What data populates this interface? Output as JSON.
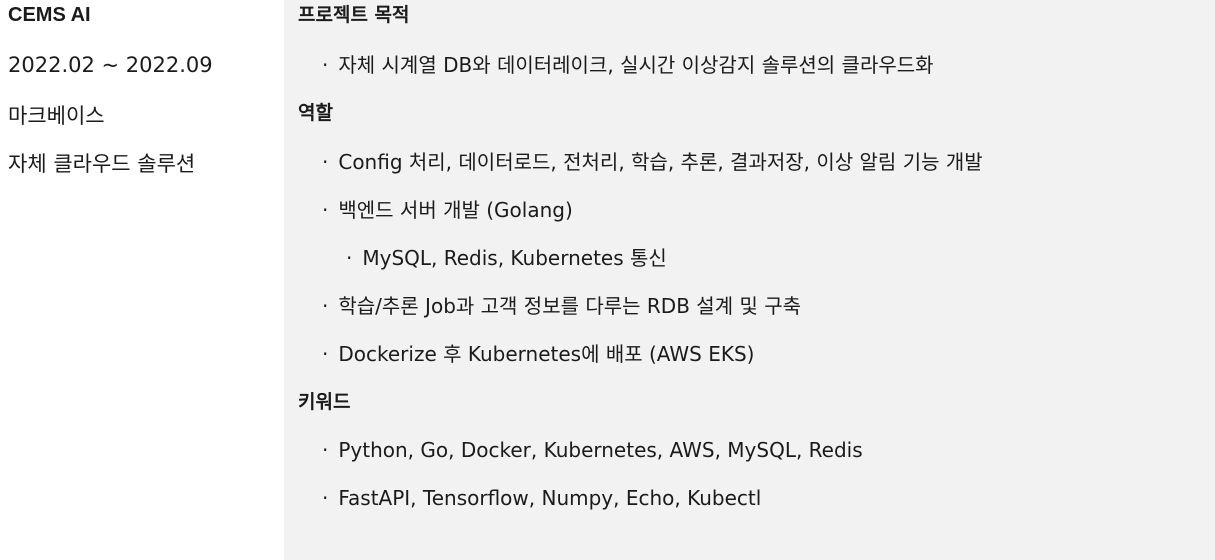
{
  "meta": {
    "company": "CEMS AI",
    "period": "2022.02 ~ 2022.09",
    "client": "마크베이스",
    "project": "자체 클라우드 솔루션"
  },
  "sections": {
    "purpose": {
      "heading": "프로젝트 목적",
      "items": [
        "자체 시계열 DB와 데이터레이크, 실시간 이상감지 솔루션의 클라우드화"
      ]
    },
    "role": {
      "heading": "역할",
      "items": [
        "Config 처리, 데이터로드, 전처리, 학습, 추론, 결과저장, 이상 알림 기능 개발",
        "백엔드 서버 개발 (Golang)",
        "MySQL, Redis, Kubernetes 통신",
        "학습/추론 Job과 고객 정보를 다루는 RDB 설계 및 구축",
        "Dockerize 후 Kubernetes에 배포 (AWS EKS)"
      ]
    },
    "keywords": {
      "heading": "키워드",
      "items": [
        "Python, Go, Docker, Kubernetes, AWS, MySQL, Redis",
        "FastAPI, Tensorflow, Numpy, Echo, Kubectl"
      ]
    }
  },
  "bullet_symbol": "·"
}
